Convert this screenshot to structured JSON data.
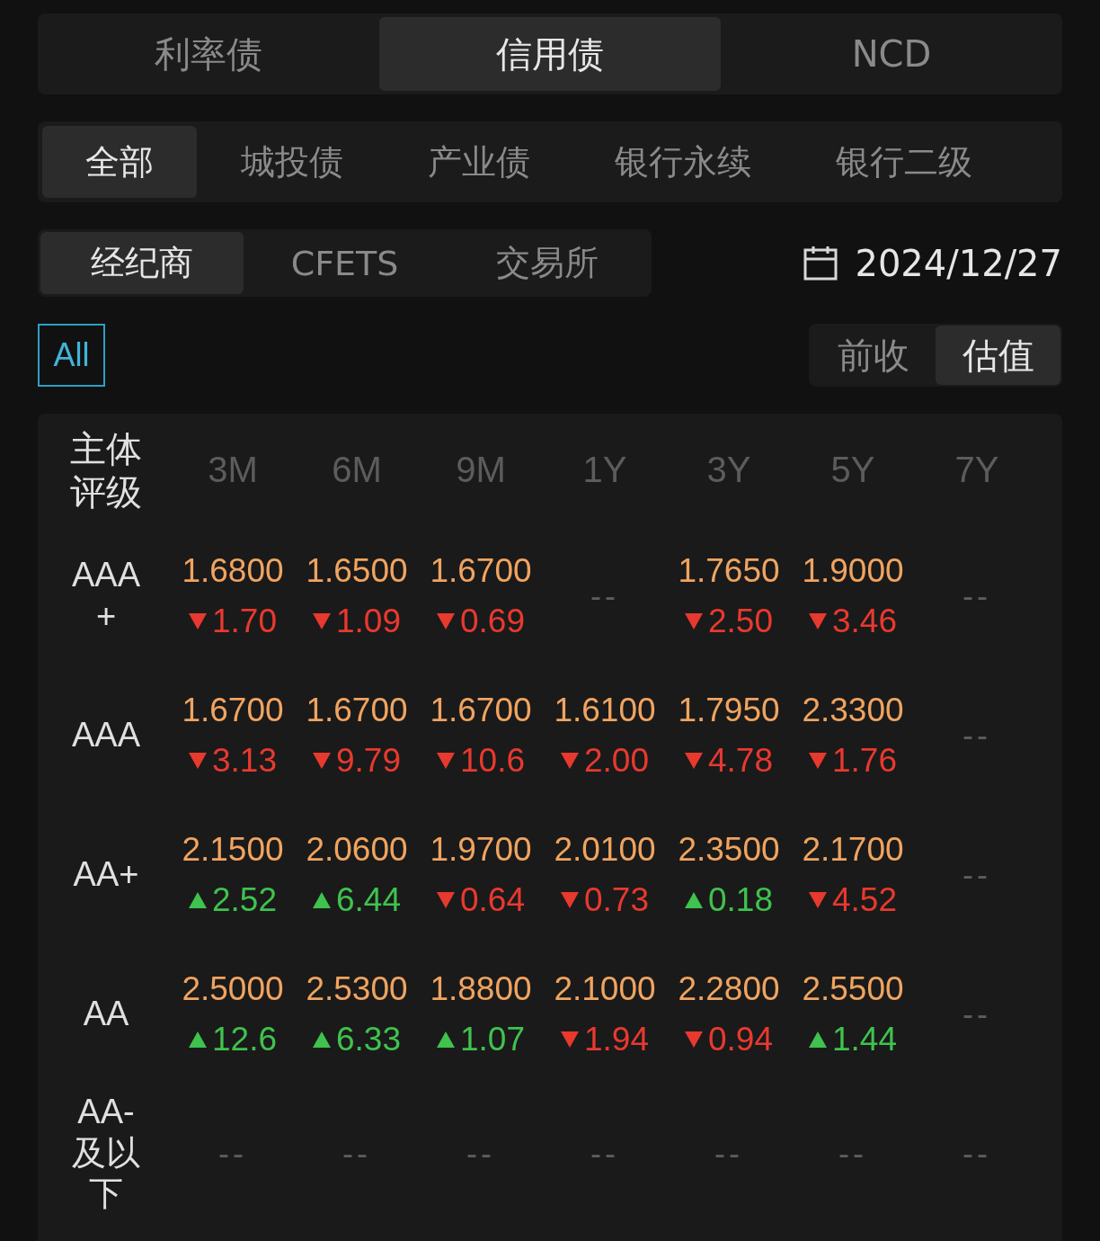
{
  "bond_tabs": [
    {
      "label": "利率债",
      "selected": false
    },
    {
      "label": "信用债",
      "selected": true
    },
    {
      "label": "NCD",
      "selected": false
    }
  ],
  "category_tabs": [
    {
      "label": "全部",
      "selected": true
    },
    {
      "label": "城投债",
      "selected": false
    },
    {
      "label": "产业债",
      "selected": false
    },
    {
      "label": "银行永续",
      "selected": false
    },
    {
      "label": "银行二级",
      "selected": false
    }
  ],
  "source_tabs": [
    {
      "label": "经纪商",
      "selected": true
    },
    {
      "label": "CFETS",
      "selected": false
    },
    {
      "label": "交易所",
      "selected": false
    }
  ],
  "date": "2024/12/27",
  "filter": {
    "label": "All",
    "selected": true
  },
  "price_tabs": [
    {
      "label": "前收",
      "selected": false
    },
    {
      "label": "估值",
      "selected": true
    }
  ],
  "table": {
    "header": "主体评级",
    "columns": [
      "3M",
      "6M",
      "9M",
      "1Y",
      "3Y",
      "5Y",
      "7Y"
    ],
    "rows": [
      {
        "rating": "AAA+",
        "cells": [
          {
            "kind": "quote",
            "value": "1.6800",
            "change": "1.70",
            "rising": false
          },
          {
            "kind": "quote",
            "value": "1.6500",
            "change": "1.09",
            "rising": false
          },
          {
            "kind": "quote",
            "value": "1.6700",
            "change": "0.69",
            "rising": false
          },
          {
            "kind": "empty",
            "text": "--"
          },
          {
            "kind": "quote",
            "value": "1.7650",
            "change": "2.50",
            "rising": false
          },
          {
            "kind": "quote",
            "value": "1.9000",
            "change": "3.46",
            "rising": false
          },
          {
            "kind": "empty",
            "text": "--"
          }
        ]
      },
      {
        "rating": "AAA",
        "cells": [
          {
            "kind": "quote",
            "value": "1.6700",
            "change": "3.13",
            "rising": false
          },
          {
            "kind": "quote",
            "value": "1.6700",
            "change": "9.79",
            "rising": false
          },
          {
            "kind": "quote",
            "value": "1.6700",
            "change": "10.6",
            "rising": false
          },
          {
            "kind": "quote",
            "value": "1.6100",
            "change": "2.00",
            "rising": false
          },
          {
            "kind": "quote",
            "value": "1.7950",
            "change": "4.78",
            "rising": false
          },
          {
            "kind": "quote",
            "value": "2.3300",
            "change": "1.76",
            "rising": false
          },
          {
            "kind": "empty",
            "text": "--"
          }
        ]
      },
      {
        "rating": "AA+",
        "cells": [
          {
            "kind": "quote",
            "value": "2.1500",
            "change": "2.52",
            "rising": true
          },
          {
            "kind": "quote",
            "value": "2.0600",
            "change": "6.44",
            "rising": true
          },
          {
            "kind": "quote",
            "value": "1.9700",
            "change": "0.64",
            "rising": false
          },
          {
            "kind": "quote",
            "value": "2.0100",
            "change": "0.73",
            "rising": false
          },
          {
            "kind": "quote",
            "value": "2.3500",
            "change": "0.18",
            "rising": true
          },
          {
            "kind": "quote",
            "value": "2.1700",
            "change": "4.52",
            "rising": false
          },
          {
            "kind": "empty",
            "text": "--"
          }
        ]
      },
      {
        "rating": "AA",
        "cells": [
          {
            "kind": "quote",
            "value": "2.5000",
            "change": "12.6",
            "rising": true
          },
          {
            "kind": "quote",
            "value": "2.5300",
            "change": "6.33",
            "rising": true
          },
          {
            "kind": "quote",
            "value": "1.8800",
            "change": "1.07",
            "rising": true
          },
          {
            "kind": "quote",
            "value": "2.1000",
            "change": "1.94",
            "rising": false
          },
          {
            "kind": "quote",
            "value": "2.2800",
            "change": "0.94",
            "rising": false
          },
          {
            "kind": "quote",
            "value": "2.5500",
            "change": "1.44",
            "rising": true
          },
          {
            "kind": "empty",
            "text": "--"
          }
        ]
      },
      {
        "rating": "AA-及以下",
        "cells": [
          {
            "kind": "empty",
            "text": "--"
          },
          {
            "kind": "empty",
            "text": "--"
          },
          {
            "kind": "empty",
            "text": "--"
          },
          {
            "kind": "empty",
            "text": "--"
          },
          {
            "kind": "empty",
            "text": "--"
          },
          {
            "kind": "empty",
            "text": "--"
          },
          {
            "kind": "empty",
            "text": "--"
          }
        ]
      }
    ]
  }
}
